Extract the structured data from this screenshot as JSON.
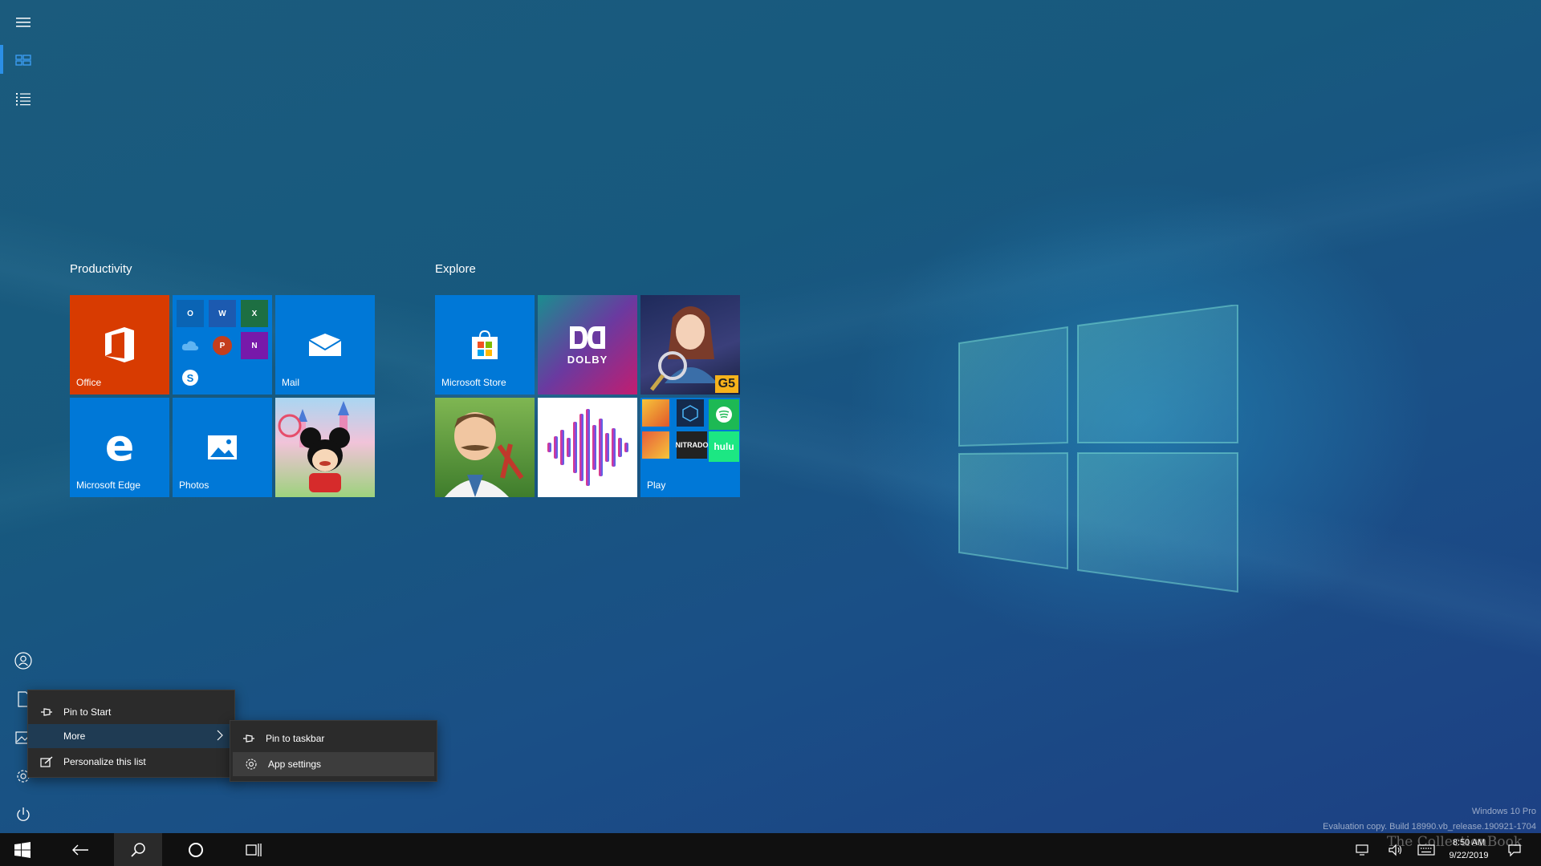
{
  "start": {
    "groups": [
      {
        "title": "Productivity",
        "tiles": [
          {
            "label": "Office",
            "color": "#d83b01",
            "icon": "office-icon"
          },
          {
            "label": "",
            "color": "#0078d7",
            "icon": "office-apps-folder"
          },
          {
            "label": "Mail",
            "color": "#0078d7",
            "icon": "mail-icon"
          },
          {
            "label": "Microsoft Edge",
            "color": "#0078d7",
            "icon": "edge-icon"
          },
          {
            "label": "Photos",
            "color": "#0078d7",
            "icon": "photos-icon"
          },
          {
            "label": "",
            "color": "#d9b7e0",
            "icon": "disney-magic-kingdoms-tile"
          }
        ]
      },
      {
        "title": "Explore",
        "tiles": [
          {
            "label": "Microsoft Store",
            "color": "#0078d7",
            "icon": "store-icon"
          },
          {
            "label": "",
            "color": "#7b2b8e",
            "icon": "dolby-icon",
            "text": "DOLBY"
          },
          {
            "label": "",
            "color": "#27325c",
            "icon": "hidden-city-game-tile",
            "badge": "G5"
          },
          {
            "label": "",
            "color": "#5a8a3a",
            "icon": "gardenscapes-game-tile"
          },
          {
            "label": "",
            "color": "#ffffff",
            "icon": "audio-waveform-tile"
          },
          {
            "label": "Play",
            "color": "#0078d7",
            "icon": "play-folder",
            "minis": [
              "NITRADO",
              "hulu"
            ]
          }
        ]
      }
    ]
  },
  "context_menu": {
    "items": [
      {
        "label": "Pin to Start",
        "icon": "pin-icon"
      },
      {
        "label": "More",
        "icon": "",
        "submenu": true
      },
      {
        "label": "Personalize this list",
        "icon": "personalize-icon"
      }
    ]
  },
  "submenu": {
    "items": [
      {
        "label": "Pin to taskbar",
        "icon": "pin-icon"
      },
      {
        "label": "App settings",
        "icon": "gear-icon"
      }
    ]
  },
  "taskbar": {
    "time": "8:50 AM",
    "date": "9/22/2019"
  },
  "desktop_watermark": {
    "line1": "Windows 10 Pro",
    "line2": "Evaluation copy. Build 18990.vb_release.190921-1704"
  },
  "brand_watermark": "The CollectionBook",
  "colors": {
    "accent": "#0078d7",
    "menu_bg": "#2b2b2b",
    "taskbar_bg": "#101010"
  }
}
